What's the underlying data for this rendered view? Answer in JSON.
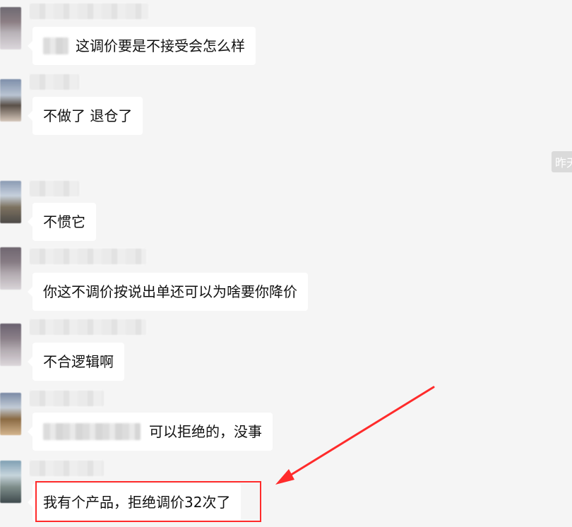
{
  "messages": [
    {
      "text": "这调价要是不接受会怎么样",
      "prefix_blur": true
    },
    {
      "text": "不做了 退仓了",
      "prefix_blur": false
    },
    {
      "text": "不惯它",
      "prefix_blur": false
    },
    {
      "text": "你这不调价按说出单还可以为啥要你降价",
      "prefix_blur": false
    },
    {
      "text": "不合逻辑啊",
      "prefix_blur": false
    },
    {
      "text": "可以拒绝的，没事",
      "prefix_blur": true
    },
    {
      "text": "我有个产品，拒绝调价32次了",
      "prefix_blur": false
    }
  ],
  "time_chip": "昨天",
  "annotation": {
    "highlight_color": "#ff2b2b",
    "arrow_color": "#ff2b2b"
  }
}
